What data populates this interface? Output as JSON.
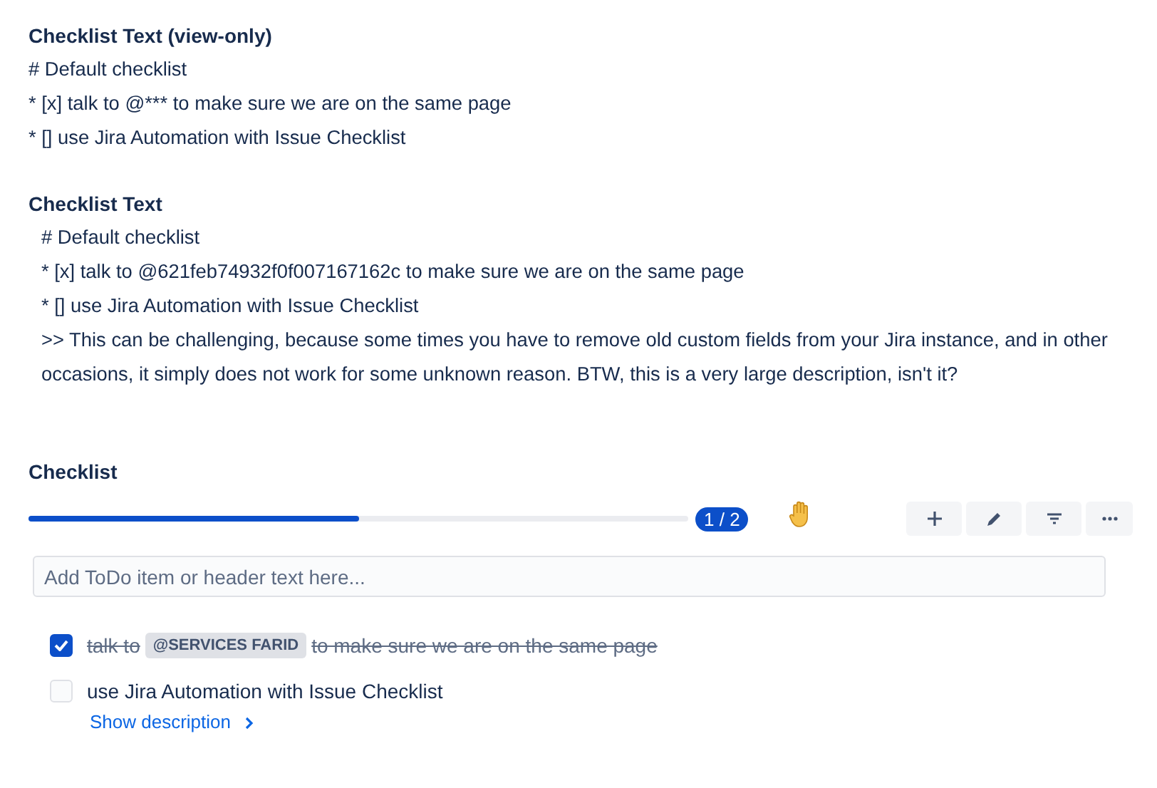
{
  "view_only": {
    "title": "Checklist Text (view-only)",
    "lines": [
      "# Default checklist",
      "* [x] talk to @*** to make sure we are on the same page",
      "* [] use Jira Automation with Issue Checklist"
    ]
  },
  "text": {
    "title": "Checklist Text",
    "lines": [
      "# Default checklist",
      "* [x] talk to @621feb74932f0f007167162c to make sure we are on the same page",
      "* [] use Jira Automation with Issue Checklist",
      ">> This can be challenging, because some times you have to remove old custom fields from your Jira instance, and in other occasions, it simply does not work for some unknown reason. BTW, this is a very large description, isn't it?"
    ]
  },
  "checklist": {
    "title": "Checklist",
    "progress": {
      "level": 0.5,
      "label": "1 / 2"
    },
    "toolbar": [
      {
        "kind": "add"
      },
      {
        "kind": "edit"
      },
      {
        "kind": "filter"
      },
      {
        "kind": "more"
      }
    ],
    "add_field": {
      "placeholder": "Add ToDo item or header text here..."
    },
    "items": [
      {
        "checked": true,
        "parts": [
          {
            "kind": "text",
            "text": "talk to"
          },
          {
            "kind": "mention",
            "text": "@SERVICES FARID"
          },
          {
            "kind": "text",
            "text": "to make sure we are on the same page"
          }
        ]
      },
      {
        "checked": false,
        "parts": [
          {
            "kind": "text",
            "text": "use Jira Automation with Issue Checklist"
          }
        ],
        "link": "Show description"
      }
    ]
  }
}
